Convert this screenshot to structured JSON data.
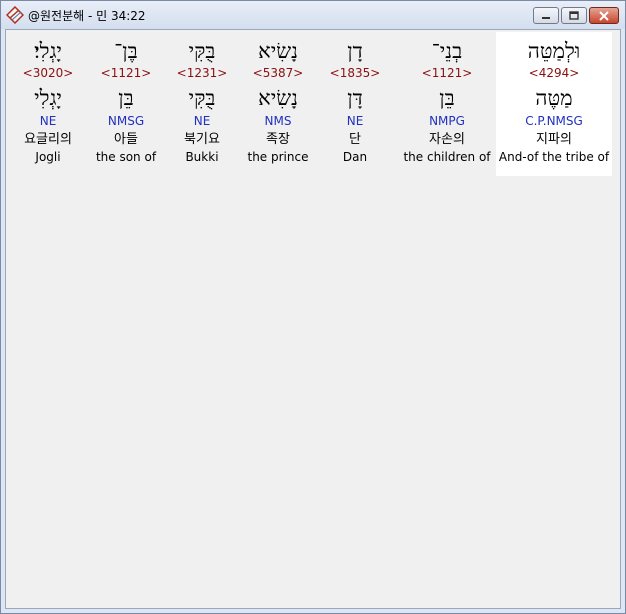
{
  "window": {
    "title": "@원전분해 - 민 34:22"
  },
  "words": [
    {
      "hebrew": "וּלְמַטֵּה",
      "strong": "<4294>",
      "lemma": "מַטֶּה",
      "morph": "C.P.NMSG",
      "korean": "지파의",
      "english": "And-of the tribe of",
      "highlighted": true
    },
    {
      "hebrew": "בְנֵי־",
      "strong": "<1121>",
      "lemma": "בֵּן",
      "morph": "NMPG",
      "korean": "자손의",
      "english": "the children of",
      "highlighted": false
    },
    {
      "hebrew": "דָן",
      "strong": "<1835>",
      "lemma": "דָּן",
      "morph": "NE",
      "korean": "단",
      "english": "Dan",
      "highlighted": false
    },
    {
      "hebrew": "נָשִׂיא",
      "strong": "<5387>",
      "lemma": "נָשִׂיא",
      "morph": "NMS",
      "korean": "족장",
      "english": "the prince",
      "highlighted": false
    },
    {
      "hebrew": "בֻּקִּי",
      "strong": "<1231>",
      "lemma": "בֻּקִּי",
      "morph": "NE",
      "korean": "북기요",
      "english": "Bukki",
      "highlighted": false
    },
    {
      "hebrew": "בֶּן־",
      "strong": "<1121>",
      "lemma": "בֵּן",
      "morph": "NMSG",
      "korean": "아들",
      "english": "the son of",
      "highlighted": false
    },
    {
      "hebrew": "יָגְלִי׃",
      "strong": "<3020>",
      "lemma": "יָגְלִי",
      "morph": "NE",
      "korean": "요글리의",
      "english": "Jogli",
      "highlighted": false
    }
  ]
}
